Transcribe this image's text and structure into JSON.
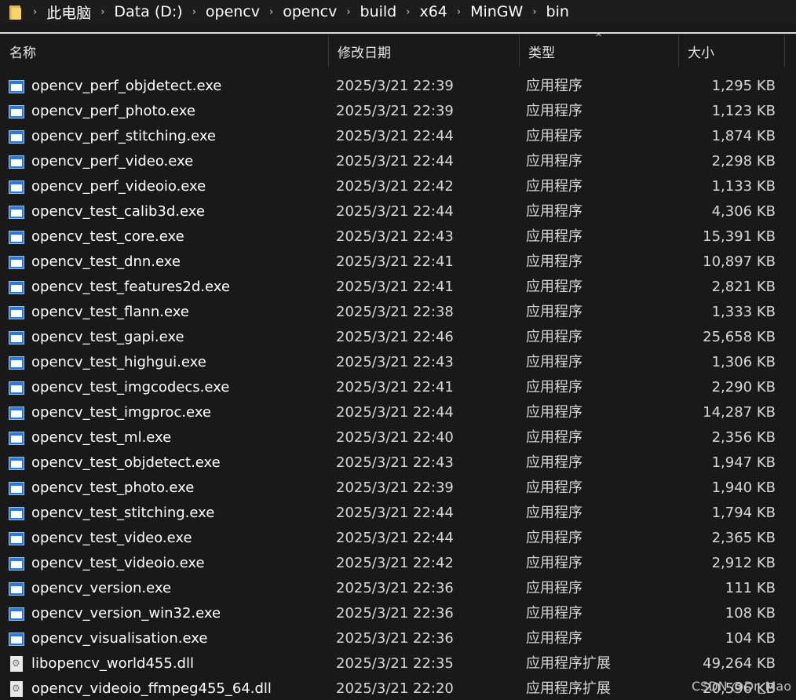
{
  "breadcrumb": [
    "此电脑",
    "Data (D:)",
    "opencv",
    "opencv",
    "build",
    "x64",
    "MinGW",
    "bin"
  ],
  "columns": {
    "name": "名称",
    "date": "修改日期",
    "type": "类型",
    "size": "大小"
  },
  "files": [
    {
      "name": "opencv_perf_objdetect.exe",
      "date": "2025/3/21 22:39",
      "type": "应用程序",
      "size": "1,295 KB",
      "icon": "exe-icon"
    },
    {
      "name": "opencv_perf_photo.exe",
      "date": "2025/3/21 22:39",
      "type": "应用程序",
      "size": "1,123 KB",
      "icon": "exe-icon"
    },
    {
      "name": "opencv_perf_stitching.exe",
      "date": "2025/3/21 22:44",
      "type": "应用程序",
      "size": "1,874 KB",
      "icon": "exe-icon"
    },
    {
      "name": "opencv_perf_video.exe",
      "date": "2025/3/21 22:44",
      "type": "应用程序",
      "size": "2,298 KB",
      "icon": "exe-icon"
    },
    {
      "name": "opencv_perf_videoio.exe",
      "date": "2025/3/21 22:42",
      "type": "应用程序",
      "size": "1,133 KB",
      "icon": "exe-icon"
    },
    {
      "name": "opencv_test_calib3d.exe",
      "date": "2025/3/21 22:44",
      "type": "应用程序",
      "size": "4,306 KB",
      "icon": "exe-icon"
    },
    {
      "name": "opencv_test_core.exe",
      "date": "2025/3/21 22:43",
      "type": "应用程序",
      "size": "15,391 KB",
      "icon": "exe-icon"
    },
    {
      "name": "opencv_test_dnn.exe",
      "date": "2025/3/21 22:41",
      "type": "应用程序",
      "size": "10,897 KB",
      "icon": "exe-icon"
    },
    {
      "name": "opencv_test_features2d.exe",
      "date": "2025/3/21 22:41",
      "type": "应用程序",
      "size": "2,821 KB",
      "icon": "exe-icon"
    },
    {
      "name": "opencv_test_flann.exe",
      "date": "2025/3/21 22:38",
      "type": "应用程序",
      "size": "1,333 KB",
      "icon": "exe-icon"
    },
    {
      "name": "opencv_test_gapi.exe",
      "date": "2025/3/21 22:46",
      "type": "应用程序",
      "size": "25,658 KB",
      "icon": "exe-icon"
    },
    {
      "name": "opencv_test_highgui.exe",
      "date": "2025/3/21 22:43",
      "type": "应用程序",
      "size": "1,306 KB",
      "icon": "exe-icon"
    },
    {
      "name": "opencv_test_imgcodecs.exe",
      "date": "2025/3/21 22:41",
      "type": "应用程序",
      "size": "2,290 KB",
      "icon": "exe-icon"
    },
    {
      "name": "opencv_test_imgproc.exe",
      "date": "2025/3/21 22:44",
      "type": "应用程序",
      "size": "14,287 KB",
      "icon": "exe-icon"
    },
    {
      "name": "opencv_test_ml.exe",
      "date": "2025/3/21 22:40",
      "type": "应用程序",
      "size": "2,356 KB",
      "icon": "exe-icon"
    },
    {
      "name": "opencv_test_objdetect.exe",
      "date": "2025/3/21 22:43",
      "type": "应用程序",
      "size": "1,947 KB",
      "icon": "exe-icon"
    },
    {
      "name": "opencv_test_photo.exe",
      "date": "2025/3/21 22:39",
      "type": "应用程序",
      "size": "1,940 KB",
      "icon": "exe-icon"
    },
    {
      "name": "opencv_test_stitching.exe",
      "date": "2025/3/21 22:44",
      "type": "应用程序",
      "size": "1,794 KB",
      "icon": "exe-icon"
    },
    {
      "name": "opencv_test_video.exe",
      "date": "2025/3/21 22:44",
      "type": "应用程序",
      "size": "2,365 KB",
      "icon": "exe-icon"
    },
    {
      "name": "opencv_test_videoio.exe",
      "date": "2025/3/21 22:42",
      "type": "应用程序",
      "size": "2,912 KB",
      "icon": "exe-icon"
    },
    {
      "name": "opencv_version.exe",
      "date": "2025/3/21 22:36",
      "type": "应用程序",
      "size": "111 KB",
      "icon": "exe-icon"
    },
    {
      "name": "opencv_version_win32.exe",
      "date": "2025/3/21 22:36",
      "type": "应用程序",
      "size": "108 KB",
      "icon": "exe-icon"
    },
    {
      "name": "opencv_visualisation.exe",
      "date": "2025/3/21 22:36",
      "type": "应用程序",
      "size": "104 KB",
      "icon": "exe-icon"
    },
    {
      "name": "libopencv_world455.dll",
      "date": "2025/3/21 22:35",
      "type": "应用程序扩展",
      "size": "49,264 KB",
      "icon": "dll-icon"
    },
    {
      "name": "opencv_videoio_ffmpeg455_64.dll",
      "date": "2025/3/21 22:20",
      "type": "应用程序扩展",
      "size": "20,596 KB",
      "icon": "dll-icon"
    }
  ],
  "watermark": "CSDN @Dr_Mao",
  "colors": {
    "background": "#191919",
    "exe_icon": "#2b78d8"
  }
}
